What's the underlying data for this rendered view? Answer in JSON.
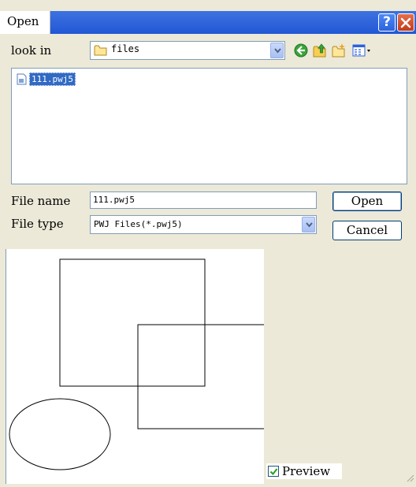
{
  "window": {
    "title": "Open"
  },
  "look_in": {
    "label": "look in",
    "value": "files"
  },
  "file_list": {
    "items": [
      {
        "name": "111.pwj5",
        "selected": true
      }
    ]
  },
  "file_name": {
    "label": "File name",
    "value": "111.pwj5"
  },
  "file_type": {
    "label": "File type",
    "value": "PWJ Files(*.pwj5)"
  },
  "buttons": {
    "open": "Open",
    "cancel": "Cancel"
  },
  "preview": {
    "label": "Preview",
    "checked": true
  },
  "colors": {
    "title_bar": "#2c62dd",
    "selection": "#316ac5",
    "dialog_bg": "#ECE9D8"
  }
}
